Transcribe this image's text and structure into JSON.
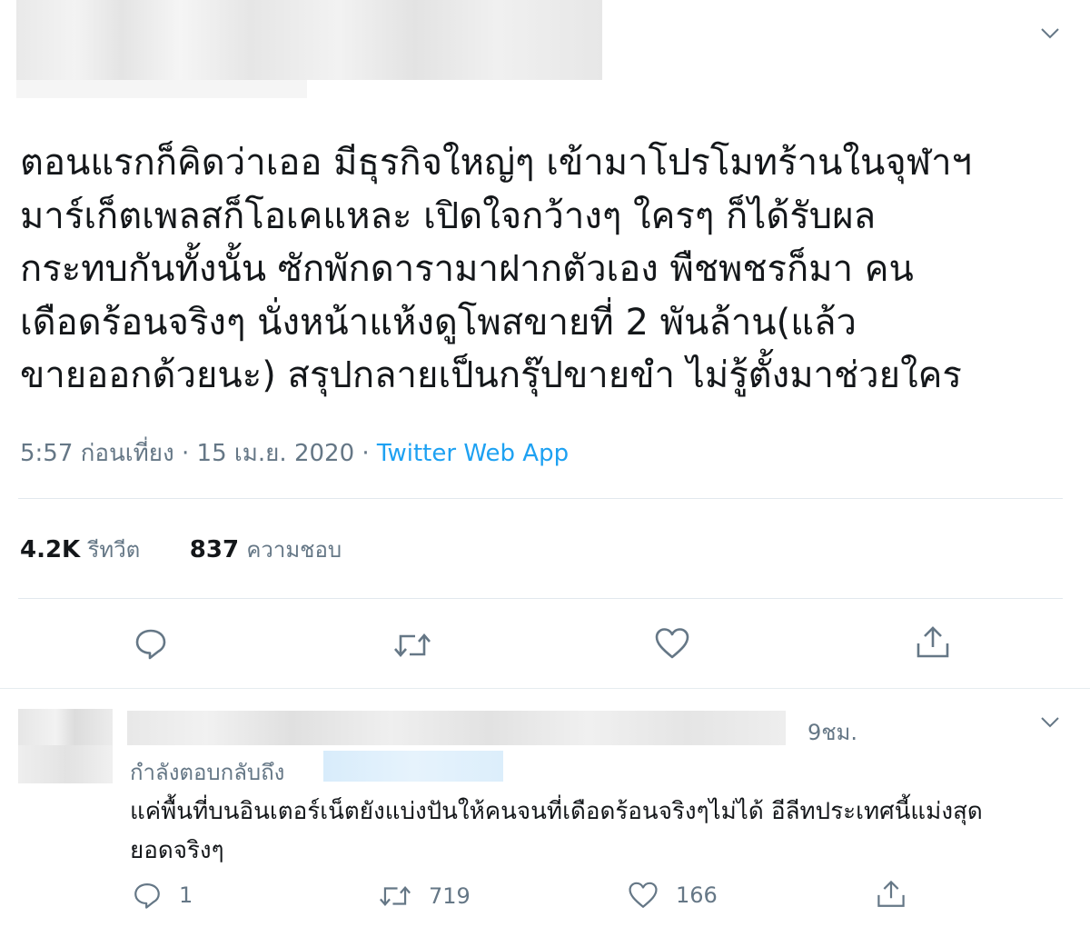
{
  "tweet": {
    "text": "ตอนแรกก็คิดว่าเออ มีธุรกิจใหญ่ๆ เข้ามาโปรโมทร้านในจุฬาฯ\nมาร์เก็ตเพลสก็โอเคแหละ เปิดใจกว้างๆ ใครๆ ก็ได้รับผล\nกระทบกันทั้งนั้น ซักพักดารามาฝากตัวเอง พืชพชรก็มา คน\nเดือดร้อนจริงๆ นั่งหน้าแห้งดูโพสขายที่ 2 พันล้าน(แล้ว\nขายออกด้วยนะ) สรุปกลายเป็นกรุ๊ปขายขำ ไม่รู้ตั้งมาช่วยใคร",
    "time": "5:57 ก่อนเที่ยง",
    "sep1": " · ",
    "date": "15 เม.ย. 2020",
    "sep2": " · ",
    "source": "Twitter Web App",
    "retweets_count": "4.2K",
    "retweets_label": "รีทวีต",
    "likes_count": "837",
    "likes_label": "ความชอบ"
  },
  "reply": {
    "time": "9ชม.",
    "replying_to": "กำลังตอบกลับถึง",
    "text": "แค่พื้นที่บนอินเตอร์เน็ตยังแบ่งปันให้คนจนที่เดือดร้อนจริงๆไม่ได้ อีลีทประเทศนี้แม่งสุด\nยอดจริงๆ",
    "reply_count": "1",
    "retweet_count": "719",
    "like_count": "166"
  },
  "icons": {
    "reply": "reply-icon",
    "retweet": "retweet-icon",
    "like": "heart-icon",
    "share": "share-icon",
    "more": "chevron-down-icon"
  },
  "colors": {
    "text": "#14171a",
    "secondary": "#657786",
    "link": "#1da1f2",
    "divider": "#e1e8ed"
  }
}
